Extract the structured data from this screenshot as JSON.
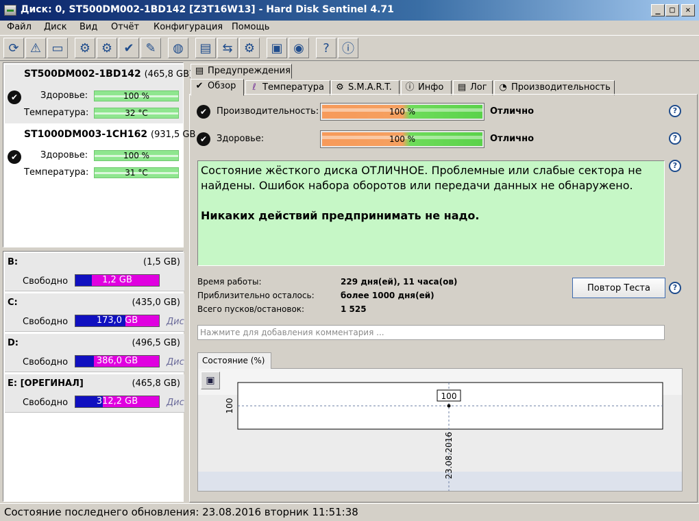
{
  "window": {
    "title": "Диск: 0, ST500DM002-1BD142 [Z3T16W13]  -  Hard Disk Sentinel 4.71",
    "minimize": "_",
    "maximize": "□",
    "close": "✕"
  },
  "menu": [
    "Файл",
    "Диск",
    "Вид",
    "Отчёт",
    "Конфигурация",
    "Помощь"
  ],
  "toolbar_icons": [
    "refresh-icon",
    "alert-icon",
    "disk-icon",
    "disk-test-icon",
    "disk-scan-icon",
    "disk-ok-icon",
    "disk-tools-icon",
    "globe-icon",
    "report-icon",
    "copy-icon",
    "disk-network-icon",
    "monitor-icon",
    "sound-icon",
    "help-icon",
    "info-icon"
  ],
  "disks": [
    {
      "name": "ST500DM002-1BD142",
      "size": "(465,8 GB)",
      "health_label": "Здоровье:",
      "health": "100 %",
      "temp_label": "Температура:",
      "temp": "32 °C"
    },
    {
      "name": "ST1000DM003-1CH162",
      "size": "(931,5 GB",
      "health_label": "Здоровье:",
      "health": "100 %",
      "temp_label": "Температура:",
      "temp": "31 °C"
    }
  ],
  "volumes": [
    {
      "letter": "B:",
      "size": "(1,5 GB)",
      "free_label": "Свободно",
      "free": "1,2 GB",
      "free_pct": 0.2,
      "extra": ""
    },
    {
      "letter": "C:",
      "size": "(435,0 GB)",
      "free_label": "Свободно",
      "free": "173,0 GB",
      "free_pct": 0.6,
      "extra": "Дис"
    },
    {
      "letter": "D:",
      "size": "(496,5 GB)",
      "free_label": "Свободно",
      "free": "386,0 GB",
      "free_pct": 0.22,
      "extra": "Дис"
    },
    {
      "letter": "E: [ОРЕГИНАЛ]",
      "size": "(465,8 GB)",
      "free_label": "Свободно",
      "free": "312,2 GB",
      "free_pct": 0.33,
      "extra": "Дис"
    }
  ],
  "tabs": {
    "warnings": "Предупреждения",
    "overview": "Обзор",
    "temperature": "Температура",
    "smart": "S.M.A.R.T.",
    "info": "Инфо",
    "log": "Лог",
    "performance": "Производительность"
  },
  "overview": {
    "performance_label": "Производительность:",
    "performance_value": "100 %",
    "performance_status": "Отлично",
    "health_label": "Здоровье:",
    "health_value": "100 %",
    "health_status": "Отлично",
    "status_text": "Состояние жёсткого диска ОТЛИЧНОЕ. Проблемные или слабые сектора не найдены. Ошибок набора оборотов или передачи данных не обнаружено.",
    "advice_text": "Никаких действий предпринимать не надо.",
    "uptime_label": "Время работы:",
    "uptime_value": "229 дня(ей), 11 часа(ов)",
    "remaining_label": "Приблизительно осталось:",
    "remaining_value": "более 1000 дня(ей)",
    "starts_label": "Всего пусков/остановок:",
    "starts_value": "1 525",
    "retest_button": "Повтор Теста",
    "comment_placeholder": "Нажмите для добавления комментария ...",
    "help": "?"
  },
  "chart_tab": "Состояние (%)",
  "chart_data": {
    "type": "line",
    "x": [
      "23.08.2016"
    ],
    "series": [
      {
        "values": [
          100
        ]
      }
    ],
    "ytick": "100",
    "point_label": "100",
    "xtick": "23.08.2016"
  },
  "statusbar": "Состояние последнего обновления: 23.08.2016 вторник 11:51:38"
}
